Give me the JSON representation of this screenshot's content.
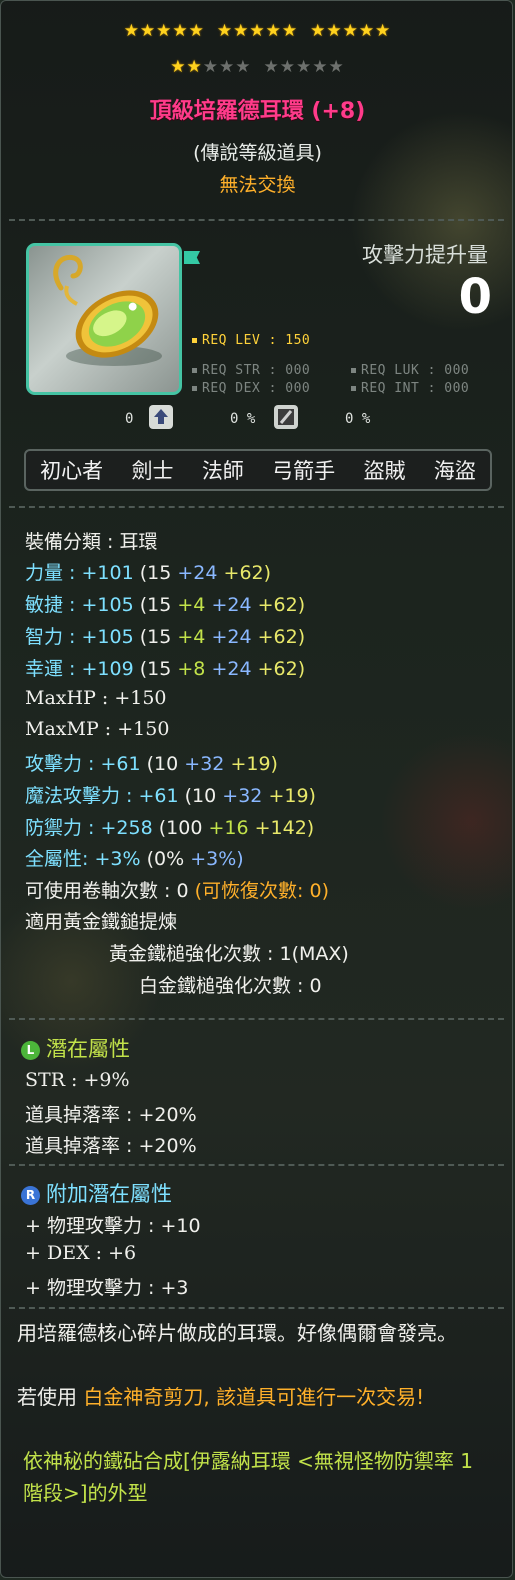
{
  "stars": {
    "row1_filled": 15,
    "row2_filled": 2,
    "row2_total": 10
  },
  "item": {
    "name": "頂級培羅德耳環 (+8)",
    "grade": "(傳說等級道具)",
    "trade": "無法交換"
  },
  "attack_increase": {
    "label": "攻擊力提升量",
    "value": "0"
  },
  "requirements": {
    "lev": "REQ LEV : 150",
    "str": "REQ STR : 000",
    "luk": "REQ LUK : 000",
    "dex": "REQ DEX : 000",
    "int": "REQ INT : 000"
  },
  "small_values": {
    "v1": "0",
    "v2": "0 %",
    "v3": "0 %"
  },
  "jobs": [
    "初心者",
    "劍士",
    "法師",
    "弓箭手",
    "盜賊",
    "海盜"
  ],
  "stats": {
    "category": "裝備分類 : 耳環",
    "str": {
      "label": "力量",
      "total": " : +101",
      "base": "(15",
      "b2": "+24",
      "b3": "+62)"
    },
    "dex": {
      "label": "敏捷",
      "total": " : +105",
      "base": "(15",
      "b1": "+4",
      "b2": "+24",
      "b3": "+62)"
    },
    "int": {
      "label": "智力",
      "total": " : +105",
      "base": "(15",
      "b1": "+4",
      "b2": "+24",
      "b3": "+62)"
    },
    "luk": {
      "label": "幸運",
      "total": " : +109",
      "base": "(15",
      "b1": "+8",
      "b2": "+24",
      "b3": "+62)"
    },
    "maxhp": "MaxHP : +150",
    "maxmp": "MaxMP : +150",
    "atk": {
      "label": "攻擊力",
      "total": " : +61",
      "base": "(10",
      "b2": "+32",
      "b3": "+19)"
    },
    "matk": {
      "label": "魔法攻擊力",
      "total": " : +61",
      "base": "(10",
      "b2": "+32",
      "b3": "+19)"
    },
    "def": {
      "label": "防禦力",
      "total": " : +258",
      "base": "(100",
      "b1": "+16",
      "b3": "+142)"
    },
    "allstat": {
      "label": "全屬性",
      "total": ": +3%",
      "base": "(0%",
      "b2": "+3%)"
    },
    "scrolls": "可使用卷軸次數 : 0",
    "recover": "(可恢復次數: 0)",
    "hammer_title": "適用黃金鐵鎚提煉",
    "gold_hammer": "黃金鐵槌強化次數 : 1(MAX)",
    "platinum_hammer": "白金鐵槌強化次數 : 0"
  },
  "potential": {
    "badge": "L",
    "title": "潛在屬性",
    "lines": [
      "STR : +9%",
      "道具掉落率 : +20%",
      "道具掉落率 : +20%"
    ]
  },
  "additional": {
    "badge": "R",
    "title": "附加潛在屬性",
    "lines": [
      "+ 物理攻擊力 : +10",
      "+ DEX : +6",
      "+ 物理攻擊力 : +3"
    ]
  },
  "description": {
    "text1": "用培羅德核心碎片做成的耳環。好像偶爾會發亮。",
    "text2a": "若使用",
    "text2b": "白金神奇剪刀, 該道具可進行一次交易!",
    "text3": "依神秘的鐵砧合成[伊露納耳環 <無視怪物防禦率 1階段>]的外型"
  },
  "colors": {
    "title": "#ff3b8a",
    "trade": "#ffb02a",
    "flame": "#8ab8ff",
    "starforce": "#e8e86a",
    "frame": "#45c4a4"
  }
}
